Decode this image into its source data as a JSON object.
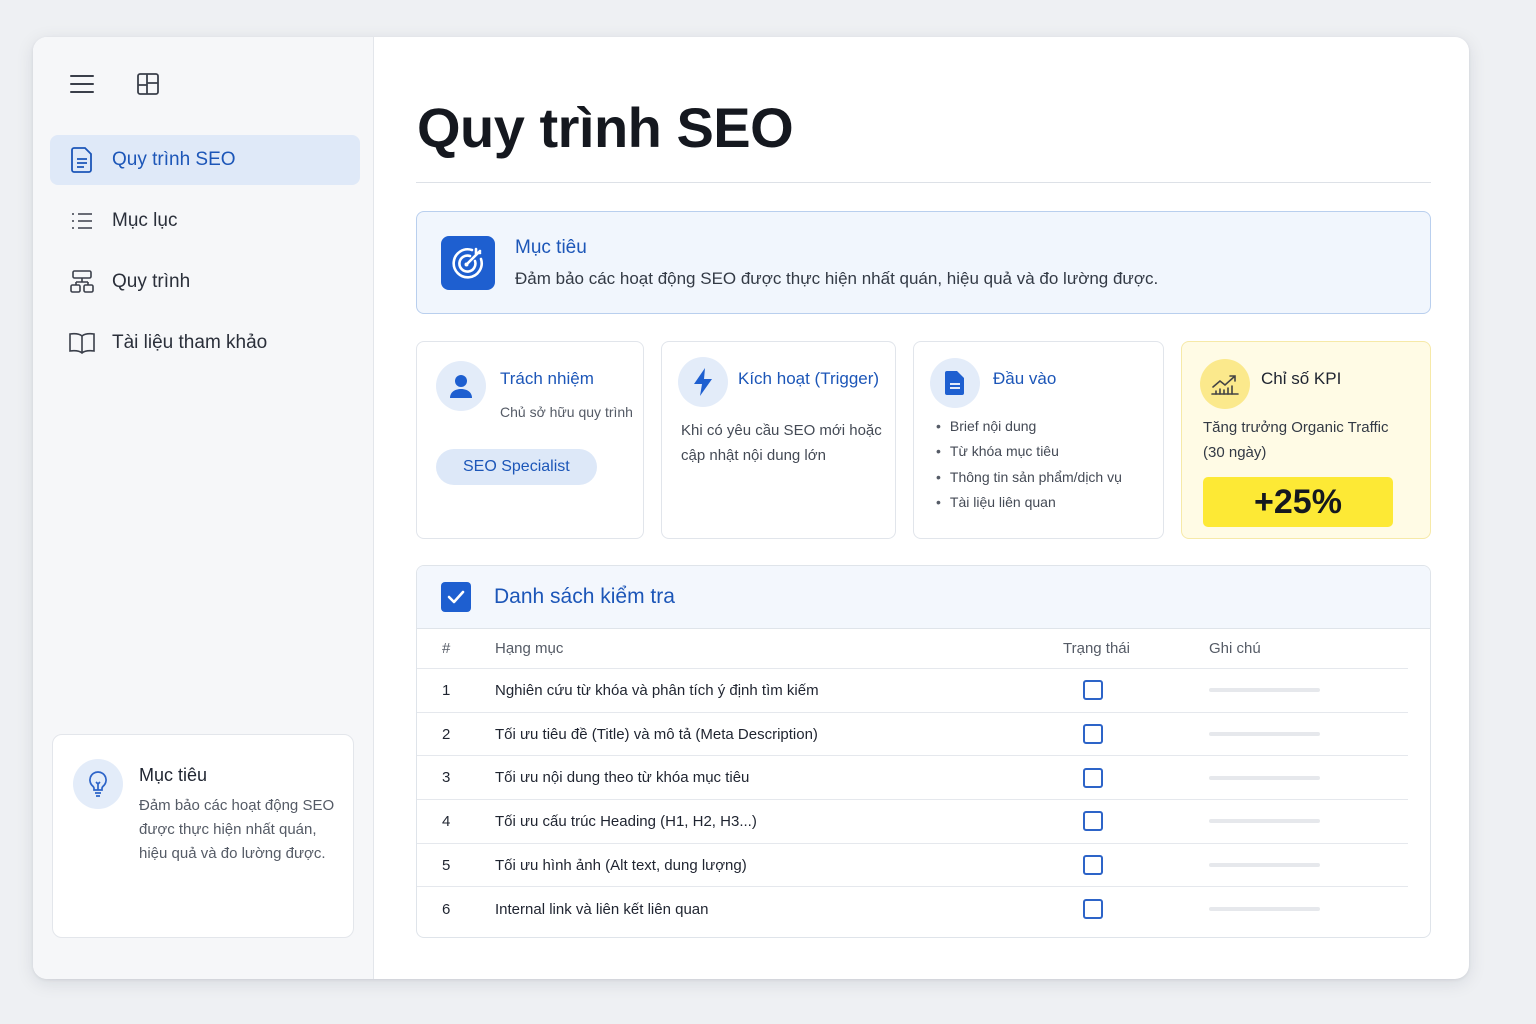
{
  "sidebar": {
    "items": [
      {
        "label": "Quy trình SEO",
        "icon": "document-icon",
        "active": true
      },
      {
        "label": "Mục lục",
        "icon": "list-icon",
        "active": false
      },
      {
        "label": "Quy trình",
        "icon": "flowchart-icon",
        "active": false
      },
      {
        "label": "Tài liệu tham khảo",
        "icon": "book-icon",
        "active": false
      }
    ],
    "card": {
      "title": "Mục tiêu",
      "desc": "Đảm bảo các hoạt động SEO được thực hiện nhất quán, hiệu quả và đo lường được."
    }
  },
  "main": {
    "title": "Quy trình SEO",
    "goal": {
      "title": "Mục tiêu",
      "desc": "Đảm bảo các hoạt động SEO được thực hiện nhất quán, hiệu quả và đo lường được."
    },
    "cards": {
      "responsibility": {
        "title": "Trách nhiệm",
        "sub": "Chủ sở hữu quy trình",
        "badge": "SEO Specialist"
      },
      "trigger": {
        "title": "Kích hoạt (Trigger)",
        "text": "Khi có yêu cầu SEO mới hoặc cập nhật nội dung lớn"
      },
      "input": {
        "title": "Đầu vào",
        "items": [
          "Brief nội dung",
          "Từ khóa mục tiêu",
          "Thông tin sản phẩm/dịch vụ",
          "Tài liệu liên quan"
        ]
      },
      "kpi": {
        "title": "Chỉ số KPI",
        "text": "Tăng trưởng Organic Traffic (30 ngày)",
        "value": "+25%"
      }
    },
    "checklist": {
      "title": "Danh sách kiểm tra",
      "columns": {
        "num": "#",
        "item": "Hạng mục",
        "status": "Trạng thái",
        "note": "Ghi chú"
      },
      "rows": [
        {
          "num": "1",
          "item": "Nghiên cứu từ khóa và phân tích ý định tìm kiếm",
          "checked": false
        },
        {
          "num": "2",
          "item": "Tối ưu tiêu đề (Title) và mô tả (Meta Description)",
          "checked": false
        },
        {
          "num": "3",
          "item": "Tối ưu nội dung theo từ khóa mục tiêu",
          "checked": false
        },
        {
          "num": "4",
          "item": "Tối ưu cấu trúc Heading (H1, H2, H3...)",
          "checked": false
        },
        {
          "num": "5",
          "item": "Tối ưu hình ảnh (Alt text, dung lượng)",
          "checked": false
        },
        {
          "num": "6",
          "item": "Internal link và liên kết liên quan",
          "checked": false
        }
      ]
    }
  },
  "colors": {
    "accent": "#1e5fd0",
    "kpi_highlight": "#fde935"
  }
}
